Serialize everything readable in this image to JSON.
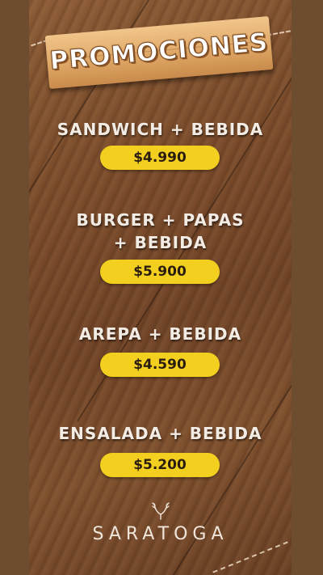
{
  "header": {
    "title": "PROMOCIONES"
  },
  "promotions": [
    {
      "name": "SANDWICH + BEBIDA",
      "price": "$4.990"
    },
    {
      "name": "BURGER + PAPAS\n+ BEBIDA",
      "name_line1": "BURGER + PAPAS",
      "name_line2": "+ BEBIDA",
      "price": "$5.900"
    },
    {
      "name": "AREPA + BEBIDA",
      "price": "$4.590"
    },
    {
      "name": "ENSALADA + BEBIDA",
      "price": "$5.200"
    }
  ],
  "footer": {
    "brand": "SARATOGA",
    "logo_icon": "antlers-icon"
  },
  "colors": {
    "price_pill": "#f3cf1f",
    "price_text": "#2b1d0e",
    "sign_wood": "#dfa766",
    "background_wood": "#7a4b2a",
    "text_light": "#f3ece4"
  }
}
